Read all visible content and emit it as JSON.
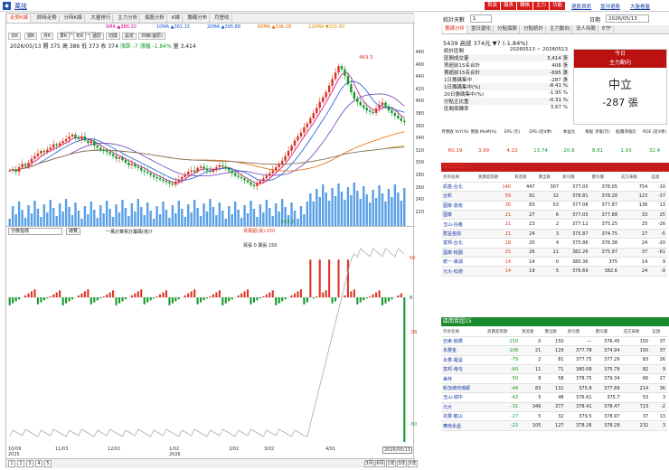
{
  "window": {
    "title": "萬技"
  },
  "top_right": {
    "buttons": [
      "首頁",
      "報表",
      "轉帳",
      "主力",
      "功能"
    ],
    "links": [
      "選股資訊",
      "當沖選股",
      "大盤看盤"
    ],
    "menu": "功能選單"
  },
  "left": {
    "tabs": [
      "走勢K線",
      "即時走勢",
      "分時K線",
      "大量排行",
      "主力分析",
      "個股分析",
      "K線",
      "籌碼分布",
      "月營收"
    ],
    "ma": [
      {
        "label": "5MA ▲388.20",
        "color": "#d4008c"
      },
      {
        "label": "10MA ▲361.15",
        "color": "#1a58d8"
      },
      {
        "label": "20MA ▲395.88",
        "color": "#1a58d8"
      },
      {
        "label": "60MA ▲336.28",
        "color": "#e26a00"
      },
      {
        "label": "120MA ▼331.00",
        "color": "#d99000"
      },
      {
        "label": "240MA ▲349.84",
        "color": "#777"
      }
    ],
    "tools": [
      "日K",
      "週K",
      "月K",
      "季K",
      "年K",
      "還原",
      "切換",
      "設定",
      "日線(還原)"
    ],
    "info": {
      "date": "2026/05/13",
      "open": "開 375",
      "high": "高 386",
      "low": "低 373",
      "close": "收 374",
      "change": "漲跌 -7",
      "pct": "漲幅 -1.84%",
      "vol": "量 3,414"
    },
    "peak": "463.5",
    "trough": "243.5",
    "yticks": [
      "480",
      "460",
      "440",
      "420",
      "400",
      "380",
      "360",
      "340",
      "320",
      "300",
      "280",
      "260",
      "240",
      "220"
    ],
    "sub": {
      "select": "分散指標",
      "btn": "總覽",
      "legend1": "一萬計算累計籌碼(億)?",
      "legend2": "買賣超(張)-150",
      "legend3": "買張 0 賣張 150",
      "val1": "50",
      "val2": "0",
      "val3": "-38",
      "val4": "-50"
    },
    "xticks": [
      "10/09",
      "11/03",
      "12/01",
      "1/02",
      "2/02",
      "3/02",
      "4/01",
      "5/04"
    ],
    "xyear": [
      "2025",
      "2026"
    ],
    "xend": "2026/05/13",
    "pages": [
      "1",
      "2",
      "3",
      "4",
      "5"
    ],
    "ranges": [
      "3月",
      "6月",
      "1年",
      "3年",
      "5年"
    ]
  },
  "right": {
    "days_label": "統計天數",
    "days_value": "1",
    "period_label": "日期",
    "period_value": "2026/05/13",
    "tabs": [
      "籌碼分析",
      "當日變化",
      "分點個股",
      "分點統計",
      "主力動向",
      "法人持股",
      "ETF"
    ],
    "stock": "5439 高技  374元 ▼7 (-1.84%)",
    "stats": [
      {
        "k": "統計區間",
        "v": "20260513 ~ 20260513"
      },
      {
        "k": "區間成交量",
        "v": "3,414 張"
      },
      {
        "k": "買超前15名合計",
        "v": "408 張"
      },
      {
        "k": "賣超前15名合計",
        "v": "-695 張"
      },
      {
        "k": "1日籌碼集中",
        "v": "-287 張"
      },
      {
        "k": "1日籌碼集中(%)",
        "v": "-8.41 %"
      },
      {
        "k": "20日籌碼集中(%)",
        "v": "-1.95 %"
      },
      {
        "k": "分點主比重",
        "v": "-0.31 %"
      },
      {
        "k": "區間周轉率",
        "v": "3.67 %"
      }
    ],
    "today": {
      "title": "今日",
      "sub": "主力動向",
      "status": "中立",
      "amount": "-287 張"
    },
    "metrics_head": [
      "月營收 YoY(%)",
      "營收 MoM(%)",
      "EPS (元)",
      "EPS (近4季)",
      "本益比",
      "每股 淨值(元)",
      "股價淨值比",
      "ROE (近4季)"
    ],
    "metrics": [
      "60.19",
      "3.99",
      "4.22",
      "13.74",
      "20.8",
      "8.81",
      "1.93",
      "32.4"
    ],
    "buy": {
      "title": "區間買超15",
      "cols": [
        "券商名稱",
        "買賣超張數",
        "買進數",
        "賣出數",
        "買均價",
        "賣均價",
        "成交筆數",
        "差額"
      ],
      "rows": [
        [
          "凱基-台北",
          "140",
          "447",
          "307",
          "377.05",
          "378.05",
          "754",
          "-10"
        ],
        [
          "台新",
          "59",
          "91",
          "32",
          "378.81",
          "378.28",
          "123",
          "-37"
        ],
        [
          "國泰-敦南",
          "30",
          "83",
          "53",
          "377.08",
          "377.87",
          "136",
          "13"
        ],
        [
          "國泰",
          "21",
          "27",
          "6",
          "377.05",
          "377.88",
          "33",
          "25"
        ],
        [
          "玉山-信義",
          "21",
          "23",
          "2",
          "377.12",
          "375.25",
          "25",
          "-26"
        ],
        [
          "群益金鼎",
          "21",
          "24",
          "3",
          "375.87",
          "374.75",
          "27",
          "-5"
        ],
        [
          "富邦-台北",
          "18",
          "20",
          "4",
          "375.86",
          "376.38",
          "24",
          "-20"
        ],
        [
          "國泰-桃園",
          "15",
          "26",
          "11",
          "382.26",
          "375.97",
          "37",
          "-61"
        ],
        [
          "統一-東湖",
          "14",
          "14",
          "0",
          "380.36",
          "375",
          "14",
          "9"
        ],
        [
          "元大-松德",
          "14",
          "19",
          "5",
          "376.69",
          "382.6",
          "24",
          "-9"
        ]
      ]
    },
    "sell": {
      "title": "區間賣超15",
      "cols": [
        "券商名稱",
        "買賣超張數",
        "買進數",
        "賣出數",
        "買均價",
        "賣均價",
        "成交筆數",
        "差額"
      ],
      "rows": [
        [
          "亞東-板橋",
          "-150",
          "0",
          "150",
          "—",
          "376.45",
          "150",
          "37"
        ],
        [
          "永豐金",
          "-108",
          "21",
          "129",
          "377.78",
          "374.94",
          "150",
          "37"
        ],
        [
          "永豐-羅遠",
          "-79",
          "2",
          "81",
          "377.75",
          "377.29",
          "83",
          "26"
        ],
        [
          "富邦-南屯",
          "-60",
          "11",
          "71",
          "380.08",
          "375.79",
          "82",
          "9"
        ],
        [
          "美林",
          "-50",
          "8",
          "58",
          "378.75",
          "379.34",
          "66",
          "27"
        ],
        [
          "新加坡商瑞銀",
          "-48",
          "83",
          "131",
          "375.8",
          "377.89",
          "214",
          "36"
        ],
        [
          "玉山-城中",
          "-43",
          "5",
          "48",
          "376.61",
          "375.7",
          "53",
          "3"
        ],
        [
          "元大",
          "-31",
          "346",
          "377",
          "378.41",
          "378.47",
          "723",
          "-2"
        ],
        [
          "兆豐-龍山",
          "-27",
          "5",
          "32",
          "379.5",
          "378.97",
          "37",
          "13"
        ],
        [
          "華南永昌",
          "-22",
          "105",
          "127",
          "378.26",
          "378.29",
          "232",
          "3"
        ]
      ]
    }
  }
}
